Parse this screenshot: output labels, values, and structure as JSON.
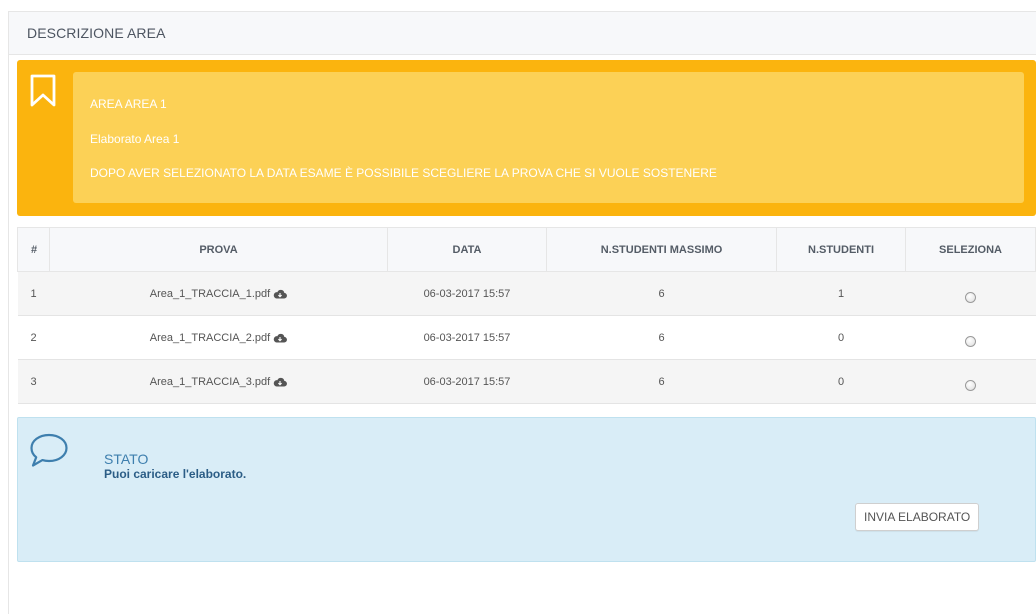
{
  "panel": {
    "title": "DESCRIZIONE AREA"
  },
  "alert": {
    "area": "AREA AREA 1",
    "elaborato": "Elaborato Area 1",
    "note": "DOPO AVER SELEZIONATO LA DATA ESAME È POSSIBILE SCEGLIERE LA PROVA CHE SI VUOLE SOSTENERE",
    "icon": "bookmark-icon",
    "color": "#fbb40e"
  },
  "table": {
    "headers": [
      "#",
      "PROVA",
      "DATA",
      "N.STUDENTI MASSIMO",
      "N.STUDENTI",
      "SELEZIONA"
    ],
    "rows": [
      {
        "num": "1",
        "prova": "Area_1_TRACCIA_1.pdf",
        "data": "06-03-2017 15:57",
        "max": "6",
        "studenti": "1"
      },
      {
        "num": "2",
        "prova": "Area_1_TRACCIA_2.pdf",
        "data": "06-03-2017 15:57",
        "max": "6",
        "studenti": "0"
      },
      {
        "num": "3",
        "prova": "Area_1_TRACCIA_3.pdf",
        "data": "06-03-2017 15:57",
        "max": "6",
        "studenti": "0"
      }
    ]
  },
  "stato": {
    "title": "STATO",
    "message": "Puoi caricare l'elaborato.",
    "button": "INVIA ELABORATO",
    "icon": "chat-bubble-icon",
    "color": "#d9edf7"
  }
}
